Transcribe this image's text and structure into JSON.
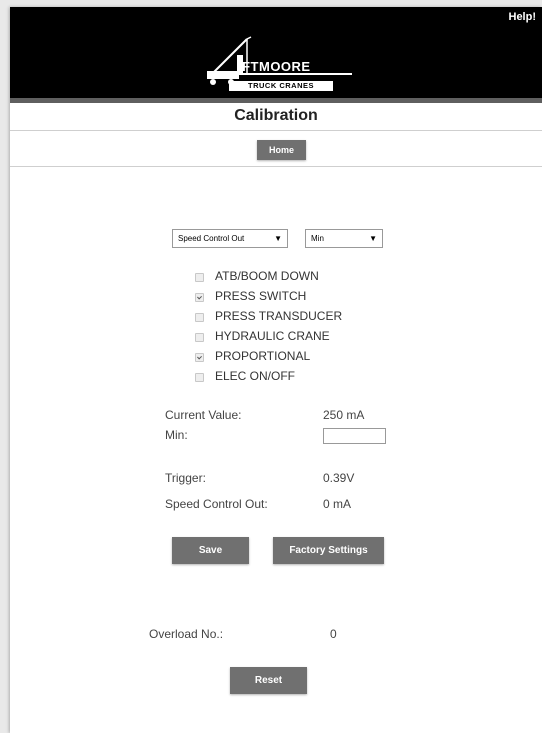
{
  "header": {
    "help_label": "Help!",
    "logo_text": "IFTMOORE",
    "logo_tagline": "TRUCK CRANES"
  },
  "title": "Calibration",
  "nav": {
    "home_label": "Home"
  },
  "selects": {
    "channel": {
      "value": "Speed Control Out"
    },
    "mode": {
      "value": "Min"
    }
  },
  "options": [
    {
      "label": "ATB/BOOM DOWN",
      "checked": false
    },
    {
      "label": "PRESS SWITCH",
      "checked": true
    },
    {
      "label": "PRESS TRANSDUCER",
      "checked": false
    },
    {
      "label": "HYDRAULIC CRANE",
      "checked": false
    },
    {
      "label": "PROPORTIONAL",
      "checked": true
    },
    {
      "label": "ELEC ON/OFF",
      "checked": false
    }
  ],
  "readings": {
    "current_value_label": "Current Value:",
    "current_value": "250 mA",
    "min_label": "Min:",
    "trigger_label": "Trigger:",
    "trigger_value": "0.39V",
    "speed_label": "Speed Control Out:",
    "speed_value": "0 mA"
  },
  "buttons": {
    "save": "Save",
    "factory": "Factory Settings",
    "reset": "Reset"
  },
  "overload": {
    "label": "Overload No.:",
    "value": "0"
  },
  "colors": {
    "header_bg": "#000000",
    "button_bg": "#707070"
  }
}
